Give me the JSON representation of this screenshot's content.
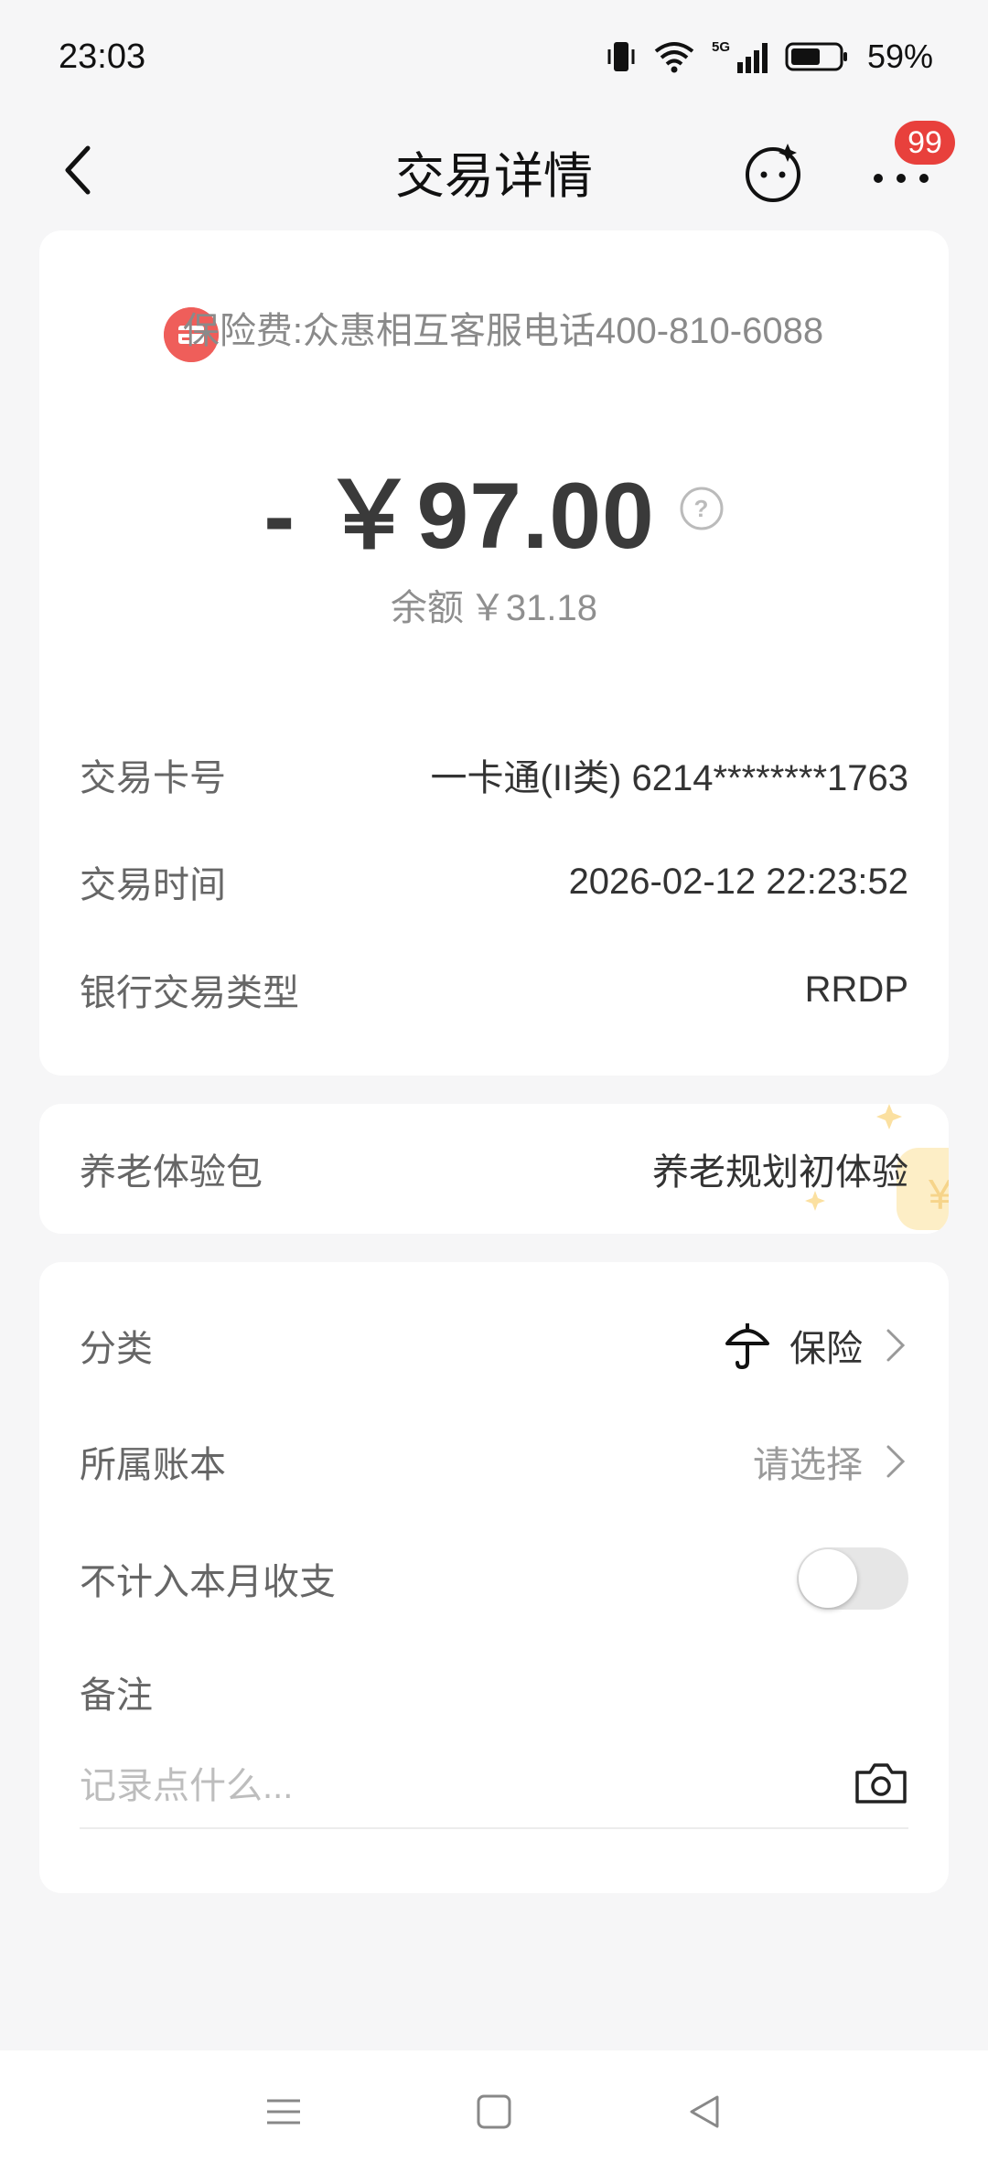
{
  "status_bar": {
    "time": "23:03",
    "network": "5G",
    "battery": "59%"
  },
  "nav": {
    "title": "交易详情",
    "badge": "99"
  },
  "transaction": {
    "merchant": "保险费:众惠相互客服电话400-810-6088",
    "amount": "- ￥97.00",
    "balance_label": "余额",
    "balance_value": "￥31.18"
  },
  "details": [
    {
      "label": "交易卡号",
      "value": "一卡通(II类) 6214********1763"
    },
    {
      "label": "交易时间",
      "value": "2026-02-12 22:23:52"
    },
    {
      "label": "银行交易类型",
      "value": "RRDP"
    }
  ],
  "pension": {
    "label": "养老体验包",
    "value": "养老规划初体验"
  },
  "extra": {
    "category_label": "分类",
    "category_value": "保险",
    "ledger_label": "所属账本",
    "ledger_value": "请选择",
    "exclude_label": "不计入本月收支",
    "exclude_enabled": false,
    "note_label": "备注",
    "note_placeholder": "记录点什么..."
  },
  "icons": {
    "back": "chevron-left-icon",
    "bot": "smiley-bot-icon",
    "more": "more-dots-icon",
    "merchant": "card-icon",
    "help": "question-circle-icon",
    "category": "umbrella-icon",
    "camera": "camera-icon"
  },
  "colors": {
    "accent_red": "#e8403c",
    "merchant_icon": "#ef5e5a",
    "background": "#f6f6f7"
  }
}
